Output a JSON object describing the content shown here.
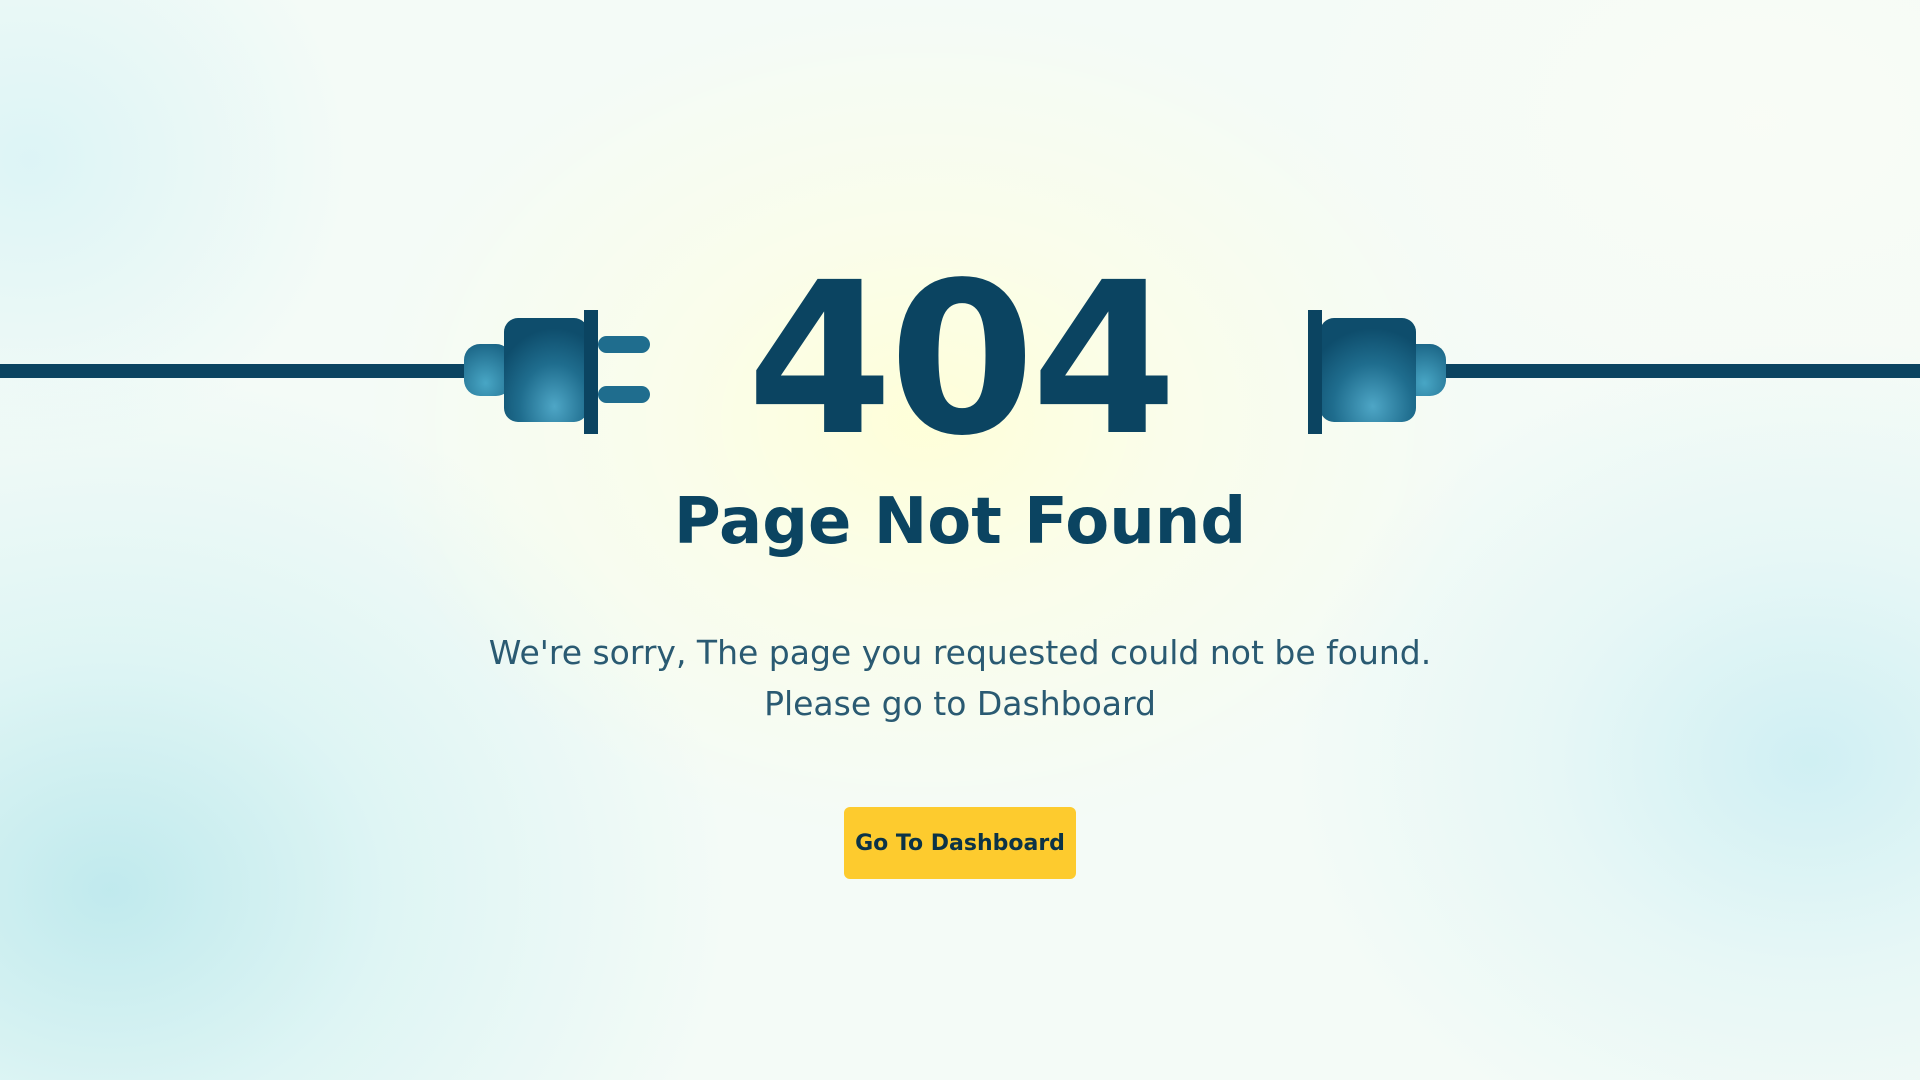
{
  "error": {
    "code": "404",
    "title": "Page Not Found",
    "message_line1": "We're sorry, The page you requested could not be found.",
    "message_line2": "Please go to Dashboard"
  },
  "actions": {
    "dashboard_button_label": "Go To Dashboard"
  },
  "illustration": {
    "left": "unplugged-plug-icon",
    "right": "power-socket-icon"
  },
  "colors": {
    "primary": "#0b4461",
    "button": "#fdcb2e",
    "plug_highlight": "#3a9cbf"
  }
}
